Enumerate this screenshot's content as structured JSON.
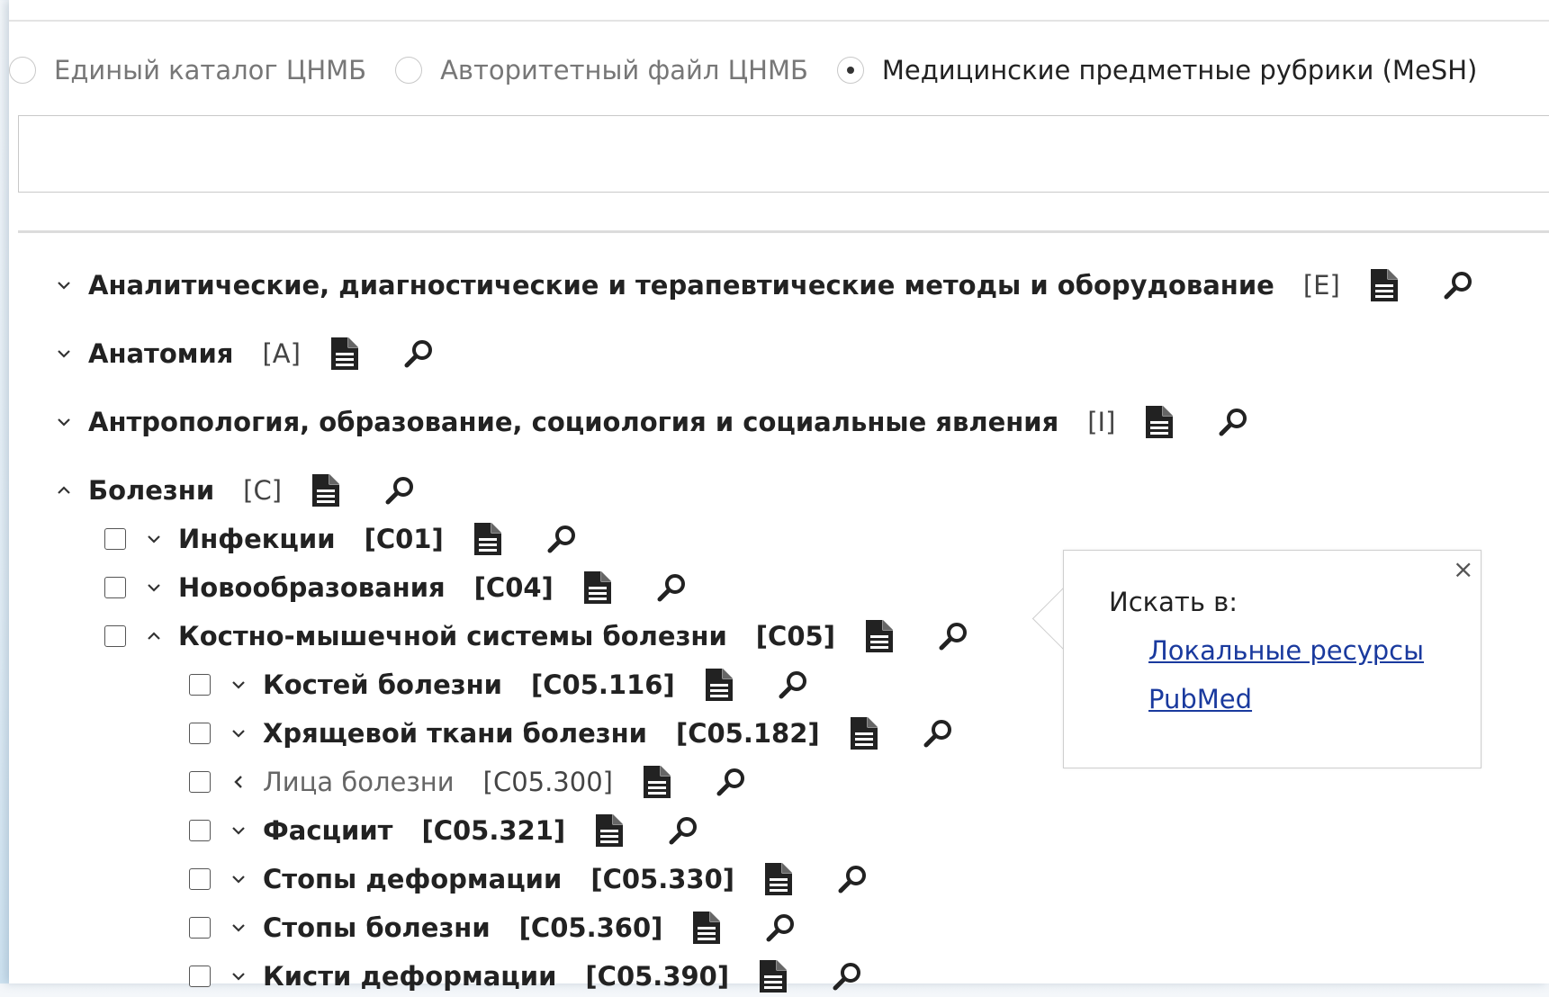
{
  "radios": [
    {
      "label": "Единый каталог ЦНМБ",
      "checked": false
    },
    {
      "label": "Авторитетный файл ЦНМБ",
      "checked": false
    },
    {
      "label": "Медицинские предметные рубрики (MeSH)",
      "checked": true
    }
  ],
  "search": {
    "value": "",
    "placeholder": ""
  },
  "tree": {
    "top": [
      {
        "name": "Аналитические, диагностические и терапевтические методы и оборудование",
        "code": "[E]",
        "state": "collapsed"
      },
      {
        "name": "Анатомия",
        "code": "[A]",
        "state": "collapsed"
      },
      {
        "name": "Антропология, образование, социология и социальные явления",
        "code": "[I]",
        "state": "collapsed"
      },
      {
        "name": "Болезни",
        "code": "[C]",
        "state": "expanded"
      }
    ],
    "level1": [
      {
        "name": "Инфекции",
        "code": "[C01]",
        "state": "collapsed"
      },
      {
        "name": "Новообразования",
        "code": "[C04]",
        "state": "collapsed"
      },
      {
        "name": "Костно-мышечной системы болезни",
        "code": "[C05]",
        "state": "expanded"
      }
    ],
    "level2": [
      {
        "name": "Костей болезни",
        "code": "[C05.116]",
        "state": "collapsed"
      },
      {
        "name": "Хрящевой ткани болезни",
        "code": "[C05.182]",
        "state": "collapsed"
      },
      {
        "name": "Лица болезни",
        "code": "[C05.300]",
        "state": "leaf"
      },
      {
        "name": "Фасциит",
        "code": "[C05.321]",
        "state": "collapsed"
      },
      {
        "name": "Стопы деформации",
        "code": "[C05.330]",
        "state": "collapsed"
      },
      {
        "name": "Стопы болезни",
        "code": "[C05.360]",
        "state": "collapsed"
      },
      {
        "name": "Кисти деформации",
        "code": "[C05.390]",
        "state": "collapsed"
      }
    ]
  },
  "popup": {
    "title": "Искать в:",
    "links": [
      "Локальные ресурсы",
      "PubMed"
    ],
    "close": "×"
  },
  "icons": {
    "document": "document-icon",
    "search": "magnifier-icon"
  }
}
